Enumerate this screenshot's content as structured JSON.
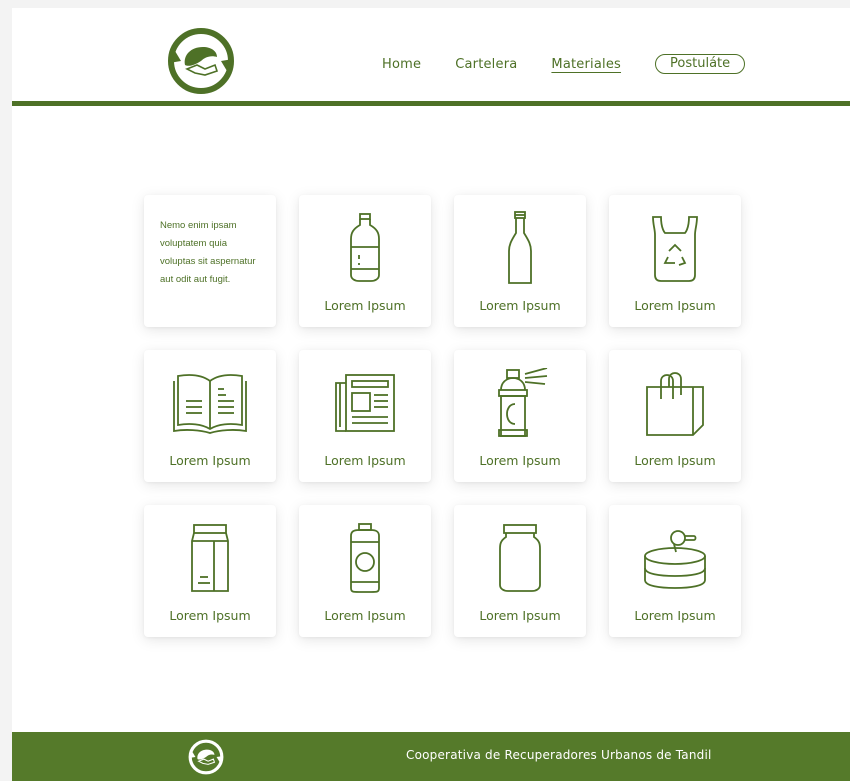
{
  "nav": {
    "items": [
      {
        "label": "Home",
        "active": false
      },
      {
        "label": "Cartelera",
        "active": false
      },
      {
        "label": "Materiales",
        "active": true
      }
    ],
    "cta_label": "Postuláte"
  },
  "intro": {
    "text": "Nemo enim ipsam voluptatem quia voluptas sit aspernatur aut odit aut fugit."
  },
  "cards": [
    {
      "icon": "plastic-bottle-icon",
      "label": "Lorem Ipsum"
    },
    {
      "icon": "glass-bottle-icon",
      "label": "Lorem Ipsum"
    },
    {
      "icon": "recycle-bag-icon",
      "label": "Lorem Ipsum"
    },
    {
      "icon": "open-book-icon",
      "label": "Lorem Ipsum"
    },
    {
      "icon": "newspaper-icon",
      "label": "Lorem Ipsum"
    },
    {
      "icon": "spray-can-icon",
      "label": "Lorem Ipsum"
    },
    {
      "icon": "shopping-bag-icon",
      "label": "Lorem Ipsum"
    },
    {
      "icon": "milk-carton-icon",
      "label": "Lorem Ipsum"
    },
    {
      "icon": "soda-can-icon",
      "label": "Lorem Ipsum"
    },
    {
      "icon": "jar-icon",
      "label": "Lorem Ipsum"
    },
    {
      "icon": "tuna-can-icon",
      "label": "Lorem Ipsum"
    }
  ],
  "footer": {
    "text": "Cooperativa de Recuperadores Urbanos de Tandil"
  },
  "colors": {
    "brand_green": "#4e7127",
    "footer_green": "#557a2a",
    "background": "#ffffff"
  }
}
